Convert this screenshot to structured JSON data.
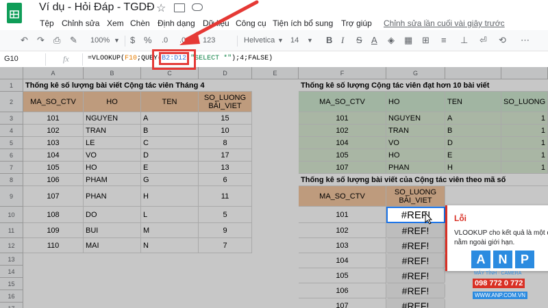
{
  "app": {
    "title": "Ví dụ - Hỏi Đáp - TGDĐ"
  },
  "menu": [
    "Tệp",
    "Chỉnh sửa",
    "Xem",
    "Chèn",
    "Định dạng",
    "Dữ liệu",
    "Công cụ",
    "Tiện ích bổ sung",
    "Trợ giúp"
  ],
  "last_edit": "Chỉnh sửa lần cuối vài giây trước",
  "toolbar": {
    "zoom": "100%",
    "currency": "$",
    "percent": "%",
    "decimals": ".0",
    "decimals2": ".00",
    "format": "123",
    "font": "Helvetica",
    "font_size": "14"
  },
  "formula_bar": {
    "cell_ref": "G10",
    "fx": "fx",
    "f1": "=VLOOKUP(",
    "f2": "F10",
    "f3": ";QUE",
    "f4": "Y(",
    "f5": "B2:D12",
    "f6": ";",
    "f7": "\"SELECT *\"",
    "f8": ");4;FALSE)"
  },
  "columns": [
    "A",
    "B",
    "C",
    "D",
    "E",
    "F",
    "G"
  ],
  "rows": [
    "1",
    "2",
    "3",
    "4",
    "5",
    "6",
    "7",
    "8",
    "9",
    "10",
    "11",
    "12",
    "13",
    "14",
    "15",
    "16",
    "17"
  ],
  "table1": {
    "title": "Thống kê số lượng bài viết Cộng tác viên Tháng 4",
    "headers": [
      "MA_SO_CTV",
      "HO",
      "TEN",
      "SO_LUONG BÀI_VIET"
    ],
    "rows": [
      [
        "101",
        "NGUYEN",
        "A",
        "15"
      ],
      [
        "102",
        "TRAN",
        "B",
        "10"
      ],
      [
        "103",
        "LE",
        "C",
        "8"
      ],
      [
        "104",
        "VO",
        "D",
        "17"
      ],
      [
        "105",
        "HO",
        "E",
        "13"
      ],
      [
        "106",
        "PHAM",
        "G",
        "6"
      ],
      [
        "107",
        "PHAN",
        "H",
        "11"
      ],
      [
        "108",
        "DO",
        "L",
        "5"
      ],
      [
        "109",
        "BUI",
        "M",
        "9"
      ],
      [
        "110",
        "MAI",
        "N",
        "7"
      ]
    ]
  },
  "table2": {
    "title": "Thống kê số lượng Cộng tác viên đạt hơn 10 bài viết",
    "headers": [
      "MA_SO_CTV",
      "HO",
      "TEN",
      "SO_LUONG"
    ],
    "rows": [
      [
        "101",
        "NGUYEN",
        "A",
        "1"
      ],
      [
        "102",
        "TRAN",
        "B",
        "1"
      ],
      [
        "104",
        "VO",
        "D",
        "1"
      ],
      [
        "105",
        "HO",
        "E",
        "1"
      ],
      [
        "107",
        "PHAN",
        "H",
        "1"
      ]
    ]
  },
  "table3": {
    "title": "Thống kê số lượng bài viết của Cộng tác viên theo mã số",
    "headers": [
      "MA_SO_CTV",
      "SO_LUONG BÀI_VIET"
    ],
    "rows": [
      [
        "101",
        "#REF!"
      ],
      [
        "102",
        "#REF!"
      ],
      [
        "103",
        "#REF!"
      ],
      [
        "104",
        "#REF!"
      ],
      [
        "105",
        "#REF!"
      ],
      [
        "106",
        "#REF!"
      ],
      [
        "107",
        "#REF!"
      ]
    ]
  },
  "error_popup": {
    "title": "Lỗi",
    "message": "VLOOKUP cho kết quả là một dải nằm ngoài giới hạn."
  },
  "watermark": {
    "brand": "ANP",
    "sub": "MÁY TÍNH · CAMERA",
    "phone": "098 772 0 772",
    "site": "WWW.ANP.COM.VN"
  },
  "colors": {
    "header_fill": "#f4c7a0",
    "sheets_green": "#0f9d58",
    "arrow": "#e53935",
    "error_red": "#d93025"
  }
}
